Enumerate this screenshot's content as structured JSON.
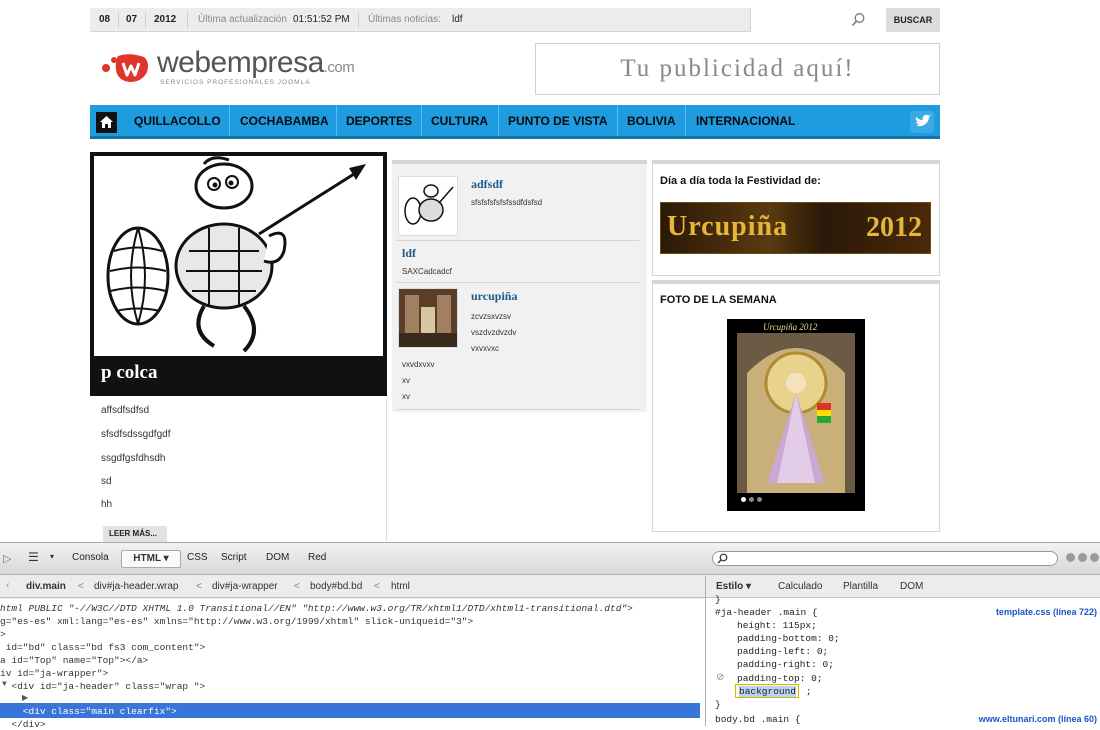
{
  "topbar": {
    "day": "08",
    "month": "07",
    "year": "2012",
    "last_update_label": "Última actualización",
    "last_update_time": "01:51:52 PM",
    "news_label": "Últimas noticias:",
    "news_text": "ldf",
    "search_button": "BUSCAR"
  },
  "header": {
    "logo_name": "webempresa",
    "logo_domain": ".com",
    "logo_subtitle": "SERVICIOS PROFESIONALES JOOMLA",
    "ad_text": "Tu publicidad aquí!"
  },
  "nav": {
    "items": [
      "QUILLACOLLO",
      "COCHABAMBA",
      "DEPORTES",
      "CULTURA",
      "PUNTO DE VISTA",
      "BOLIVIA",
      "INTERNACIONAL"
    ]
  },
  "feature": {
    "title": "p colca",
    "lines": [
      "affsdfsdfsd",
      "sfsdfsdssgdfgdf",
      "ssgdfgsfdhsdh",
      "sd",
      "hh"
    ],
    "read_more": "LEER MÁS..."
  },
  "middle": {
    "articles": [
      {
        "title": "adfsdf",
        "lines": [
          "sfsfsfsfsfsfssdfdsfsd"
        ]
      },
      {
        "title": "ldf",
        "lines": [
          "SAXCadcadcf"
        ]
      },
      {
        "title": "urcupiña",
        "lines": [
          "zcvzsxvzsv",
          "vszdvzdvzdv",
          "vxvxvxc"
        ]
      }
    ],
    "extra_lines": [
      "vxvdxvxv",
      "xv",
      "xv"
    ]
  },
  "right": {
    "box1_title": "Día a día toda la Festividad de:",
    "banner_text": "Urcupiña",
    "banner_year": "2012",
    "box2_title": "FOTO DE LA SEMANA",
    "photo_caption": "Urcupiña 2012"
  },
  "devtools": {
    "tabs": [
      "Consola",
      "HTML",
      "CSS",
      "Script",
      "DOM",
      "Red"
    ],
    "breadcrumb": [
      "div.main",
      "div#ja-header.wrap",
      "div#ja-wrapper",
      "body#bd.bd",
      "html"
    ],
    "right_tabs": [
      "Estilo",
      "Calculado",
      "Plantilla",
      "DOM"
    ],
    "code_lines": [
      "html PUBLIC \"-//W3C//DTD XHTML 1.0 Transitional//EN\" \"http://www.w3.org/TR/xhtml1/DTD/xhtml1-transitional.dtd\">",
      "g=\"es-es\" xml:lang=\"es-es\" xmlns=\"http://www.w3.org/1999/xhtml\" slick-uniqueid=\"3\">",
      ">",
      " id=\"bd\" class=\"bd fs3 com_content\">",
      "a id=\"Top\" name=\"Top\"></a>",
      "iv id=\"ja-wrapper\">",
      "  <div id=\"ja-header\" class=\"wrap \">",
      "    <div class=\"main clearfix\">",
      "  </div>"
    ],
    "css_rule1_selector": "#ja-header .main {",
    "css_rule1_source": "template.css (línea 722)",
    "css_rule1_props": [
      "height: 115px;",
      "padding-bottom: 0;",
      "padding-left: 0;",
      "padding-right: 0;",
      "padding-top: 0;"
    ],
    "css_edit_value": "background",
    "css_rule2_selector": "body.bd .main {",
    "css_rule2_source": "www.eltunari.com (línea 60)"
  }
}
